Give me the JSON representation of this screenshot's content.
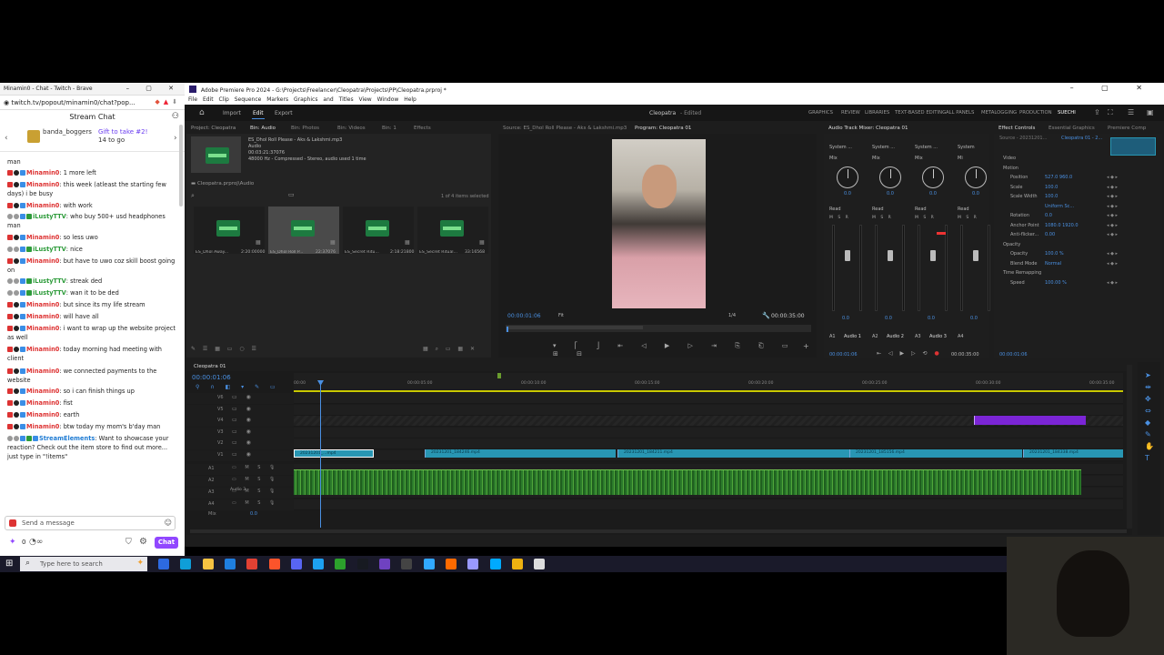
{
  "chat_window": {
    "title": "Minamin0 - Chat - Twitch - Brave",
    "url": "twitch.tv/popout/minamin0/chat?pop...",
    "header": "Stream Chat",
    "gift": {
      "user": "banda_boggers",
      "link": "Gift to take #2!",
      "sub": "14 to go"
    },
    "messages": [
      {
        "user": "",
        "text": "man",
        "color": "grn"
      },
      {
        "user": "Minamin0",
        "text": ": 1 more left",
        "color": "red"
      },
      {
        "user": "Minamin0",
        "text": ": this week (atleast the starting few days) i be busy",
        "color": "red"
      },
      {
        "user": "Minamin0",
        "text": ": with work",
        "color": "red"
      },
      {
        "user": "iLustyTTV",
        "text": ": who buy 500+ usd headphones man",
        "color": "grn"
      },
      {
        "user": "Minamin0",
        "text": ": so less uwo",
        "color": "red"
      },
      {
        "user": "iLustyTTV",
        "text": ": nice",
        "color": "grn"
      },
      {
        "user": "Minamin0",
        "text": ": but have to uwo coz skill boost going on",
        "color": "red"
      },
      {
        "user": "iLustyTTV",
        "text": ": streak ded",
        "color": "grn"
      },
      {
        "user": "iLustyTTV",
        "text": ": wan it to be ded",
        "color": "grn"
      },
      {
        "user": "Minamin0",
        "text": ": but since its my life stream",
        "color": "red"
      },
      {
        "user": "Minamin0",
        "text": ": will have all",
        "color": "red"
      },
      {
        "user": "Minamin0",
        "text": ": i want to wrap up the website project as well",
        "color": "red"
      },
      {
        "user": "Minamin0",
        "text": ": today morning had meeting with client",
        "color": "red"
      },
      {
        "user": "Minamin0",
        "text": ": we connected payments to the website",
        "color": "red"
      },
      {
        "user": "Minamin0",
        "text": ": so i can finish things up",
        "color": "red"
      },
      {
        "user": "Minamin0",
        "text": ": fist",
        "color": "red"
      },
      {
        "user": "Minamin0",
        "text": ": earth",
        "color": "red"
      },
      {
        "user": "Minamin0",
        "text": ": btw today my mom's b'day man",
        "color": "red"
      },
      {
        "user": "StreamElements",
        "text": ": Want to showcase your reaction? Check out the item store to find out more... just type in \"!items\"",
        "color": "blu"
      }
    ],
    "send_placeholder": "Send a message",
    "points": "0",
    "chat_button": "Chat"
  },
  "premiere": {
    "title": "Adobe Premiere Pro 2024 - G:\\Projects\\Freelancer\\Cleopatra\\Projects\\PP\\Cleopatra.prproj *",
    "menu": "File  Edit  Clip  Sequence  Markers  Graphics and Titles  View  Window  Help",
    "header_tabs": [
      "Import",
      "Edit",
      "Export"
    ],
    "center_title": "Cleopatra",
    "center_sub": "- Edited",
    "workspaces": [
      "GRAPHICS",
      "REVIEW",
      "LIBRARIES",
      "TEXT-BASED EDITING",
      "ALL PANELS",
      "METALOGGING",
      "PRODUCTION",
      "SUECHI"
    ],
    "project_tabs": [
      "Project: Cleopatra",
      "Bin: Audio",
      "Bin: Photos",
      "Bin: Videos",
      "Bin: 1",
      "Effects"
    ],
    "selected_file": {
      "name": "ES_Dhol Roll Please - Aks & Lakshmi.mp3",
      "type": "Audio",
      "duration": "00:03:21:37076",
      "info": "48000 Hz - Compressed - Stereo",
      "usage": ", audio used 1 time"
    },
    "bin_path": "Cleopatra.prproj\\Audio",
    "items_selected": "1 of 4 items selected",
    "thumbnails": [
      {
        "name": "ES_Dhol Away...",
        "dur": "2:20:00000"
      },
      {
        "name": "ES_Dhol Roll P...",
        "dur": "22:37076"
      },
      {
        "name": "ES_Secret Ritu...",
        "dur": "2:18:21800"
      },
      {
        "name": "ES_Secret Ritual...",
        "dur": "33:16568"
      }
    ],
    "source_tab": "Source: ES_Dhol Roll Please - Aks & Lakshmi.mp3",
    "program_tab": "Program: Cleopatra 01",
    "program_timecode": "00:00:01:06",
    "program_fit": "Fit",
    "program_ratio": "1/4",
    "program_duration": "00:00:35:00",
    "mixer_tab": "Audio Track Mixer: Cleopatra 01",
    "mixer_channels": [
      {
        "label": "System ...",
        "mode": "Mix",
        "read": "Read",
        "db": "0.0",
        "track": "A1",
        "name": "Audio 1"
      },
      {
        "label": "System ...",
        "mode": "Mix",
        "read": "Read",
        "db": "0.0",
        "track": "A2",
        "name": "Audio 2"
      },
      {
        "label": "System ...",
        "mode": "Mix",
        "read": "Read",
        "db": "0.0",
        "track": "A3",
        "name": "Audio 3"
      },
      {
        "label": "System",
        "mode": "Mi",
        "read": "Read",
        "db": "0.0",
        "track": "A4",
        "name": ""
      }
    ],
    "mixer_time_left": "00:00:01:06",
    "mixer_time_right": "00:00:35:00",
    "effects_tabs": [
      "Effect Controls",
      "Essential Graphics",
      "Premiere Comp"
    ],
    "effects_source": "Source - 20231201...",
    "effects_target": "Cleopatra 01 - 2...",
    "effects_rows": [
      {
        "label": "Video",
        "value": ""
      },
      {
        "label": "Motion",
        "value": ""
      },
      {
        "label": "Position",
        "value": "527.0   960.0"
      },
      {
        "label": "Scale",
        "value": "100.0"
      },
      {
        "label": "Scale Width",
        "value": "100.0"
      },
      {
        "label": "",
        "value": "Uniform Sc..."
      },
      {
        "label": "Rotation",
        "value": "0.0"
      },
      {
        "label": "Anchor Point",
        "value": "1080.0  1920.0"
      },
      {
        "label": "Anti-flicker...",
        "value": "0.00"
      },
      {
        "label": "Opacity",
        "value": ""
      },
      {
        "label": "Opacity",
        "value": "100.0 %"
      },
      {
        "label": "Blend Mode",
        "value": "Normal"
      },
      {
        "label": "Time Remapping",
        "value": ""
      },
      {
        "label": "Speed",
        "value": "100.00 %"
      }
    ],
    "effects_time": "00:00:01:06",
    "timeline_tab": "Cleopatra 01",
    "timeline_timecode": "00:00:01:06",
    "ruler": [
      "00:00",
      "00:00:05:00",
      "00:00:10:00",
      "00:00:15:00",
      "00:00:20:00",
      "00:00:25:00",
      "00:00:30:00",
      "00:00:35:00"
    ],
    "video_tracks": [
      "V6",
      "V5",
      "V4",
      "V3",
      "V2",
      "V1"
    ],
    "audio_tracks": [
      "A1",
      "A2",
      "A3",
      "A4"
    ],
    "audio_label": "Audio 3",
    "mix_label": "Mix",
    "mix_value": "0.0",
    "clips": [
      "20231201_...mp4",
      "20231201_184246.mp4",
      "20231201_184211.mp4",
      "20231201_185156.mp4",
      "20231201_184338.mp4"
    ]
  },
  "taskbar": {
    "search_placeholder": "Type here to search"
  }
}
